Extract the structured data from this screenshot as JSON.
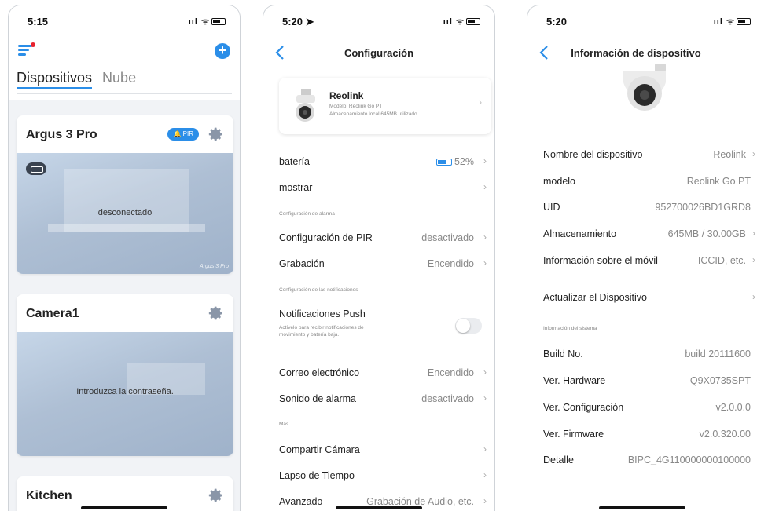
{
  "phone1": {
    "time": "5:15",
    "tabs": [
      "Dispositivos",
      "Nube"
    ],
    "cards": [
      {
        "title": "Argus 3 Pro",
        "badge": "PIR",
        "status": "desconectado",
        "watermark": "Argus 3 Pro"
      },
      {
        "title": "Camera1",
        "status": "Introduzca la contraseña."
      },
      {
        "title": "Kitchen"
      }
    ]
  },
  "phone2": {
    "time": "5:20",
    "title": "Configuración",
    "device": {
      "name": "Reolink",
      "model": "Modelo: Reolink Go PT",
      "storage": "Almacenamiento local:645MB utilizado"
    },
    "rows": {
      "battery": {
        "label": "batería",
        "value": "52%"
      },
      "display": {
        "label": "mostrar"
      },
      "alarm_section": "Configuración de alarma",
      "pir": {
        "label": "Configuración de PIR",
        "value": "desactivado"
      },
      "recording": {
        "label": "Grabación",
        "value": "Encendido"
      },
      "notif_section": "Configuración de las notificaciones",
      "push": {
        "label": "Notificaciones Push",
        "desc": "Actívelo para recibir notificaciones de movimiento y batería baja."
      },
      "email": {
        "label": "Correo electrónico",
        "value": "Encendido"
      },
      "alarm_sound": {
        "label": "Sonido de alarma",
        "value": "desactivado"
      },
      "more_section": "Más",
      "share": {
        "label": "Compartir Cámara"
      },
      "timelapse": {
        "label": "Lapso de Tiempo"
      },
      "advanced": {
        "label": "Avanzado",
        "value": "Grabación de Audio, etc."
      }
    }
  },
  "phone3": {
    "time": "5:20",
    "title": "Información de dispositivo",
    "rows": {
      "name": {
        "label": "Nombre del dispositivo",
        "value": "Reolink"
      },
      "model": {
        "label": "modelo",
        "value": "Reolink Go PT"
      },
      "uid": {
        "label": "UID",
        "value": "952700026BD1GRD8"
      },
      "storage": {
        "label": "Almacenamiento",
        "value": "645MB / 30.00GB"
      },
      "mobile": {
        "label": "Información sobre el móvil",
        "value": "ICCID, etc."
      },
      "update": {
        "label": "Actualizar el Dispositivo"
      },
      "sys_section": "Información del sistema",
      "build": {
        "label": "Build No.",
        "value": "build 20111600"
      },
      "hardware": {
        "label": "Ver. Hardware",
        "value": "Q9X0735SPT"
      },
      "config": {
        "label": "Ver. Configuración",
        "value": "v2.0.0.0"
      },
      "firmware": {
        "label": "Ver. Firmware",
        "value": "v2.0.320.00"
      },
      "detail": {
        "label": "Detalle",
        "value": "BIPC_4G110000000100000"
      }
    }
  }
}
